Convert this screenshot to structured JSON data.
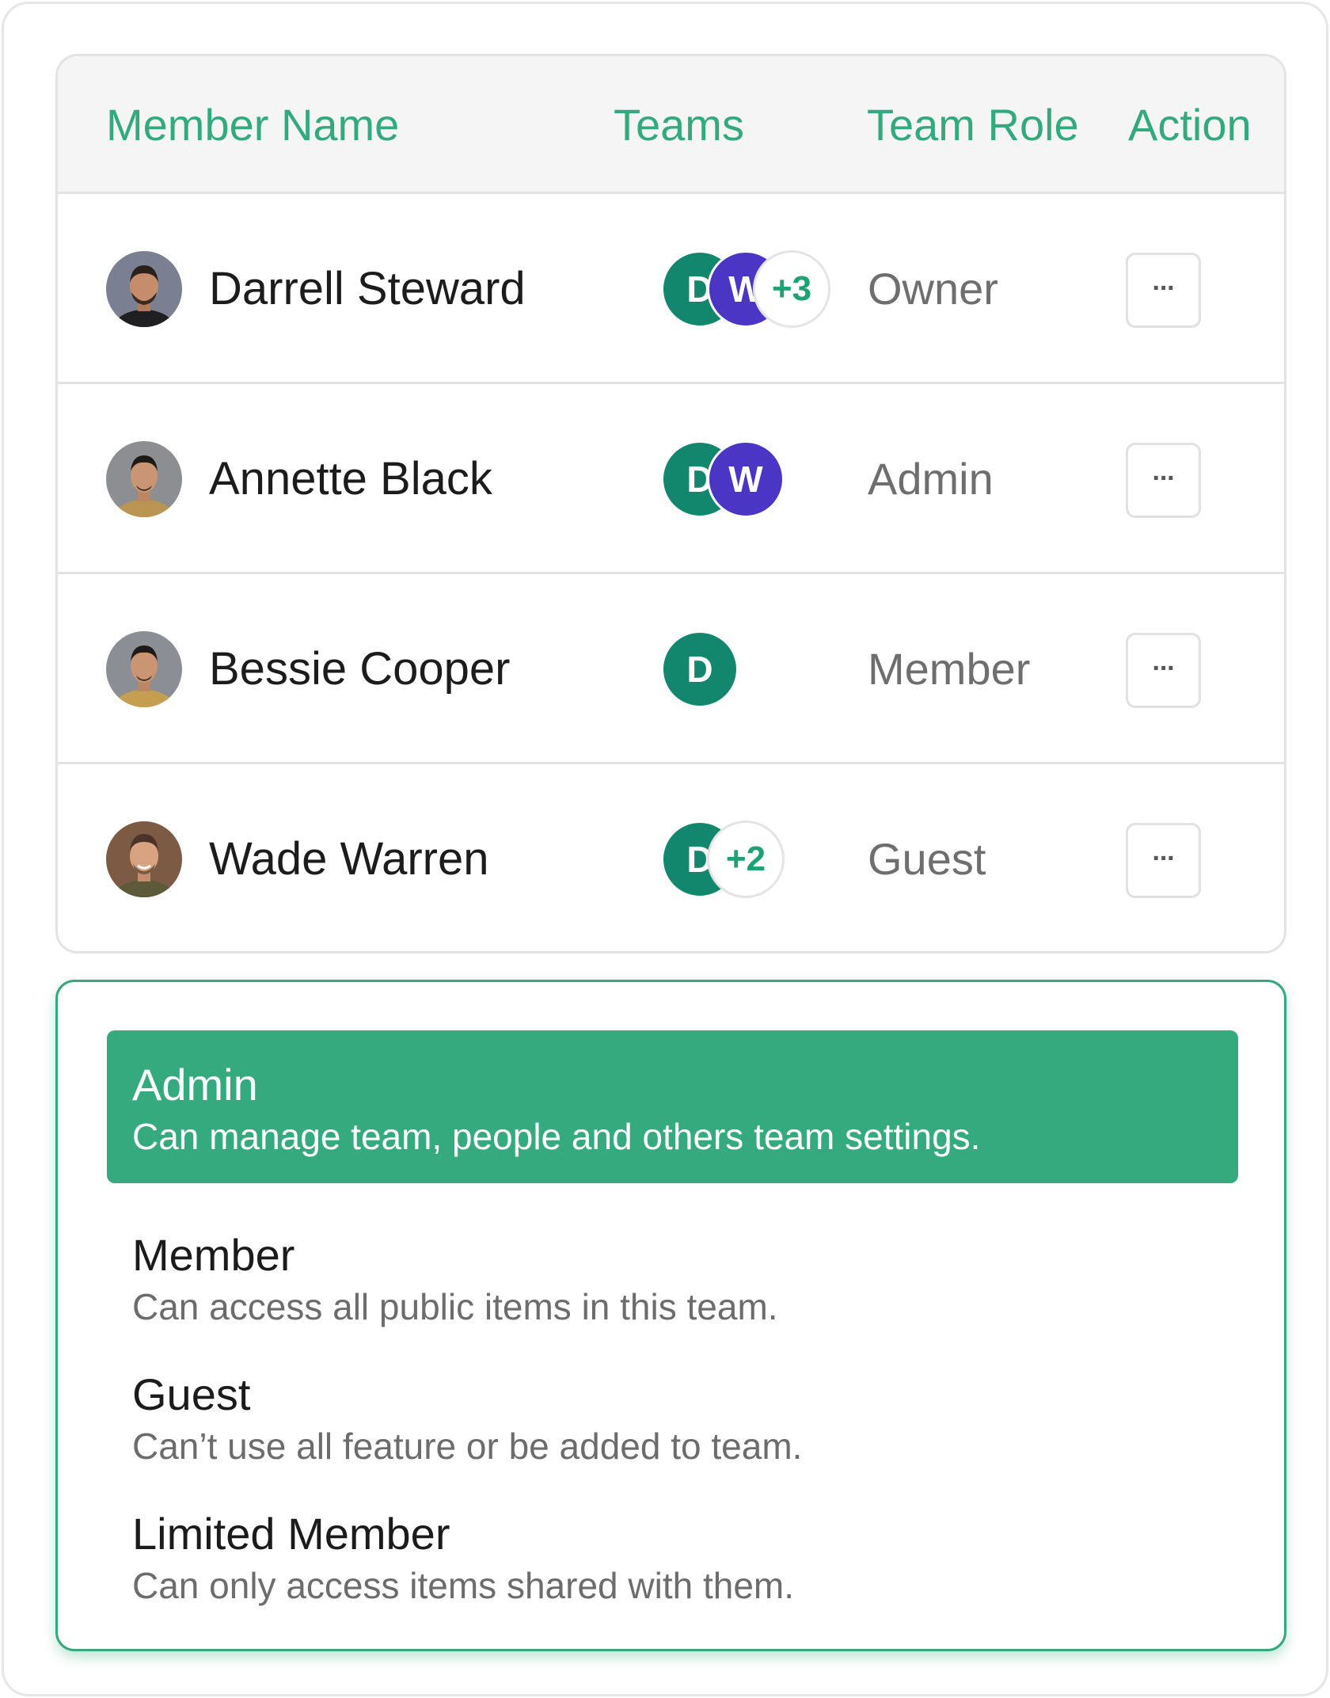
{
  "table": {
    "headers": {
      "member_name": "Member Name",
      "teams": "Teams",
      "team_role": "Team Role",
      "action": "Action"
    },
    "rows": [
      {
        "name": "Darrell Steward",
        "teams": [
          "D",
          "W",
          "+3"
        ],
        "role": "Owner",
        "action": "···"
      },
      {
        "name": "Annette Black",
        "teams": [
          "D",
          "W"
        ],
        "role": "Admin",
        "action": "···"
      },
      {
        "name": "Bessie Cooper",
        "teams": [
          "D"
        ],
        "role": "Member",
        "action": "···"
      },
      {
        "name": "Wade Warren",
        "teams": [
          "D",
          "+2"
        ],
        "role": "Guest",
        "action": "···"
      }
    ]
  },
  "role_menu": {
    "selected_index": 0,
    "items": [
      {
        "title": "Admin",
        "description": "Can manage team, people and others team settings."
      },
      {
        "title": "Member",
        "description": "Can access all public items in this team."
      },
      {
        "title": "Guest",
        "description": "Can’t use all feature or be added to team."
      },
      {
        "title": "Limited Member",
        "description": "Can only access items shared with them."
      }
    ]
  },
  "colors": {
    "accent": "#35aa7f",
    "team_d": "#13876e",
    "team_w": "#4a35c4",
    "header_bg": "#f5f5f5"
  }
}
